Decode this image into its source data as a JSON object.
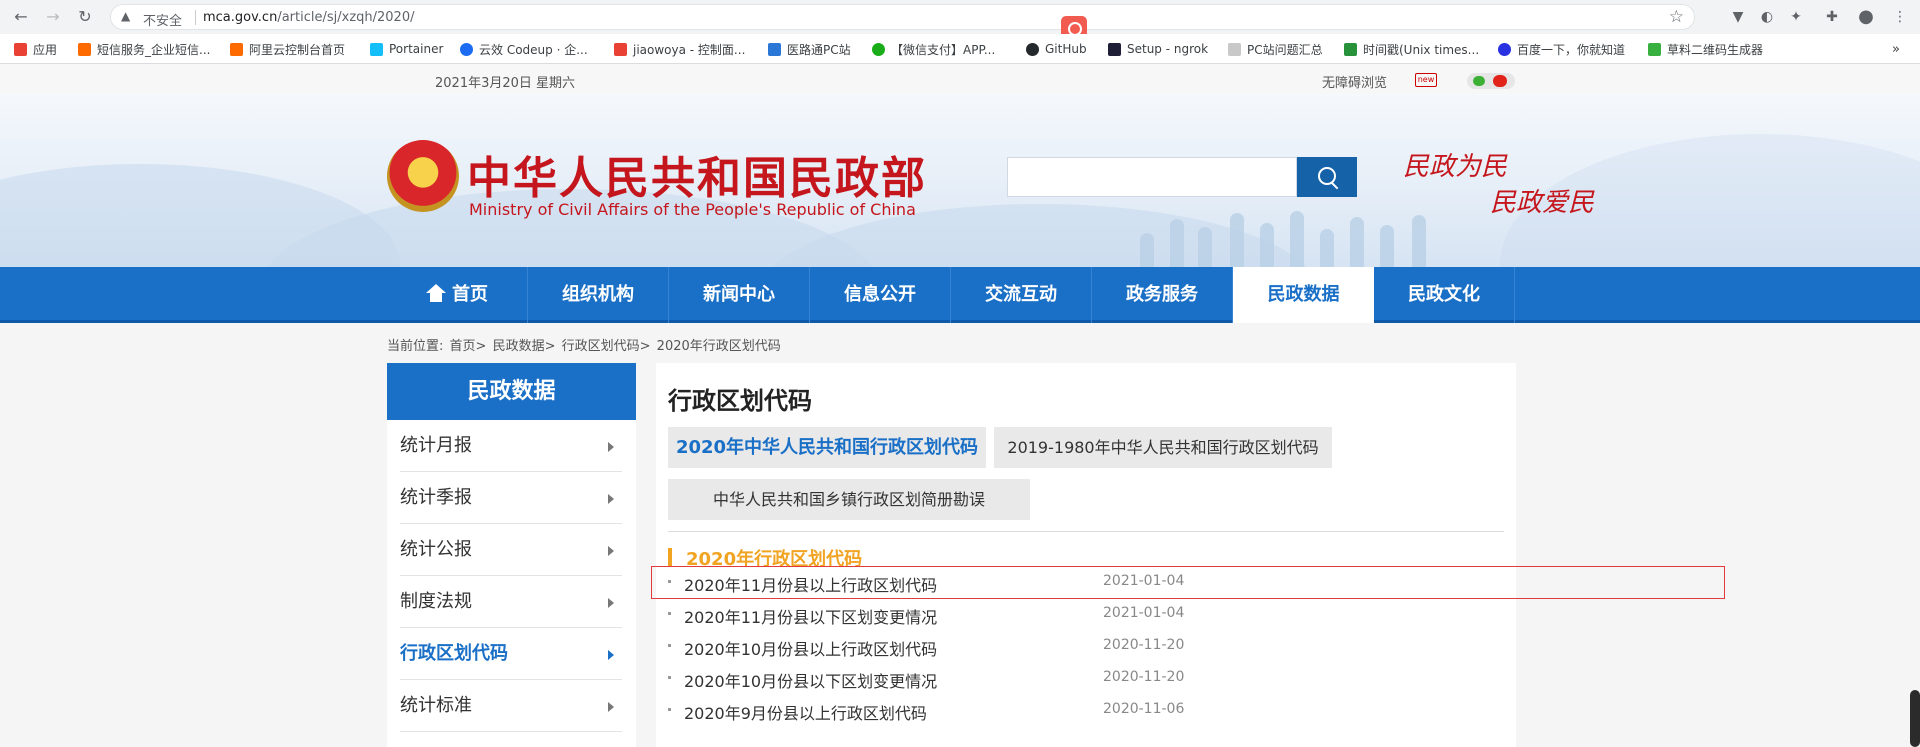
{
  "browser": {
    "security_label": "不安全",
    "url_host": "mca.gov.cn",
    "url_path": "/article/sj/xzqh/2020/",
    "bookmarks": [
      {
        "label": "应用",
        "color": "#e94235"
      },
      {
        "label": "短信服务_企业短信...",
        "color": "#ff6a00"
      },
      {
        "label": "阿里云控制台首页",
        "color": "#ff6a00"
      },
      {
        "label": "Portainer",
        "color": "#13bef9"
      },
      {
        "label": "云效 Codeup · 企...",
        "color": "#1b6cf2"
      },
      {
        "label": "jiaowoya - 控制面...",
        "color": "#e94235"
      },
      {
        "label": "医路通PC站",
        "color": "#2b77d8"
      },
      {
        "label": "【微信支付】APP...",
        "color": "#1aad19"
      },
      {
        "label": "GitHub",
        "color": "#24292e"
      },
      {
        "label": "Setup - ngrok",
        "color": "#1f1e37"
      },
      {
        "label": "PC站问题汇总",
        "color": "#c8c8c8"
      },
      {
        "label": "时间戳(Unix times...",
        "color": "#27923a"
      },
      {
        "label": "百度一下，你就知道",
        "color": "#2932e1"
      },
      {
        "label": "草料二维码生成器",
        "color": "#38b03f"
      }
    ]
  },
  "topbar": {
    "date": "2021年3月20日 星期六",
    "accessibility": "无障碍浏览",
    "new_badge": "new"
  },
  "header": {
    "title": "中华人民共和国民政部",
    "subtitle": "Ministry of Civil Affairs of the People's Republic of China",
    "slogan_line1": "民政为民",
    "slogan_line2": "民政爱民"
  },
  "nav": {
    "items": [
      {
        "label": "首页"
      },
      {
        "label": "组织机构"
      },
      {
        "label": "新闻中心"
      },
      {
        "label": "信息公开"
      },
      {
        "label": "交流互动"
      },
      {
        "label": "政务服务"
      },
      {
        "label": "民政数据"
      },
      {
        "label": "民政文化"
      }
    ],
    "active": "民政数据"
  },
  "breadcrumb": {
    "prefix": "当前位置:",
    "items": [
      "首页>",
      "民政数据>",
      "行政区划代码>",
      "2020年行政区划代码"
    ]
  },
  "sidebar": {
    "heading": "民政数据",
    "items": [
      {
        "label": "统计月报"
      },
      {
        "label": "统计季报"
      },
      {
        "label": "统计公报"
      },
      {
        "label": "制度法规"
      },
      {
        "label": "行政区划代码"
      },
      {
        "label": "统计标准"
      }
    ],
    "active": "行政区划代码"
  },
  "main": {
    "title": "行政区划代码",
    "tabs": [
      {
        "label": "2020年中华人民共和国行政区划代码"
      },
      {
        "label": "2019-1980年中华人民共和国行政区划代码"
      },
      {
        "label": "中华人民共和国乡镇行政区划简册勘误"
      }
    ],
    "section_title": "2020年行政区划代码",
    "rows": [
      {
        "title": "2020年11月份县以上行政区划代码",
        "date": "2021-01-04"
      },
      {
        "title": "2020年11月份县以下区划变更情况",
        "date": "2021-01-04"
      },
      {
        "title": "2020年10月份县以上行政区划代码",
        "date": "2020-11-20"
      },
      {
        "title": "2020年10月份县以下区划变更情况",
        "date": "2020-11-20"
      },
      {
        "title": "2020年9月份县以上行政区划代码",
        "date": "2020-11-06"
      }
    ]
  },
  "colors": {
    "primary_blue": "#1a6fc6",
    "brand_red": "#c4161c",
    "accent_orange": "#f1a322",
    "highlight_red": "#e33b3b"
  }
}
